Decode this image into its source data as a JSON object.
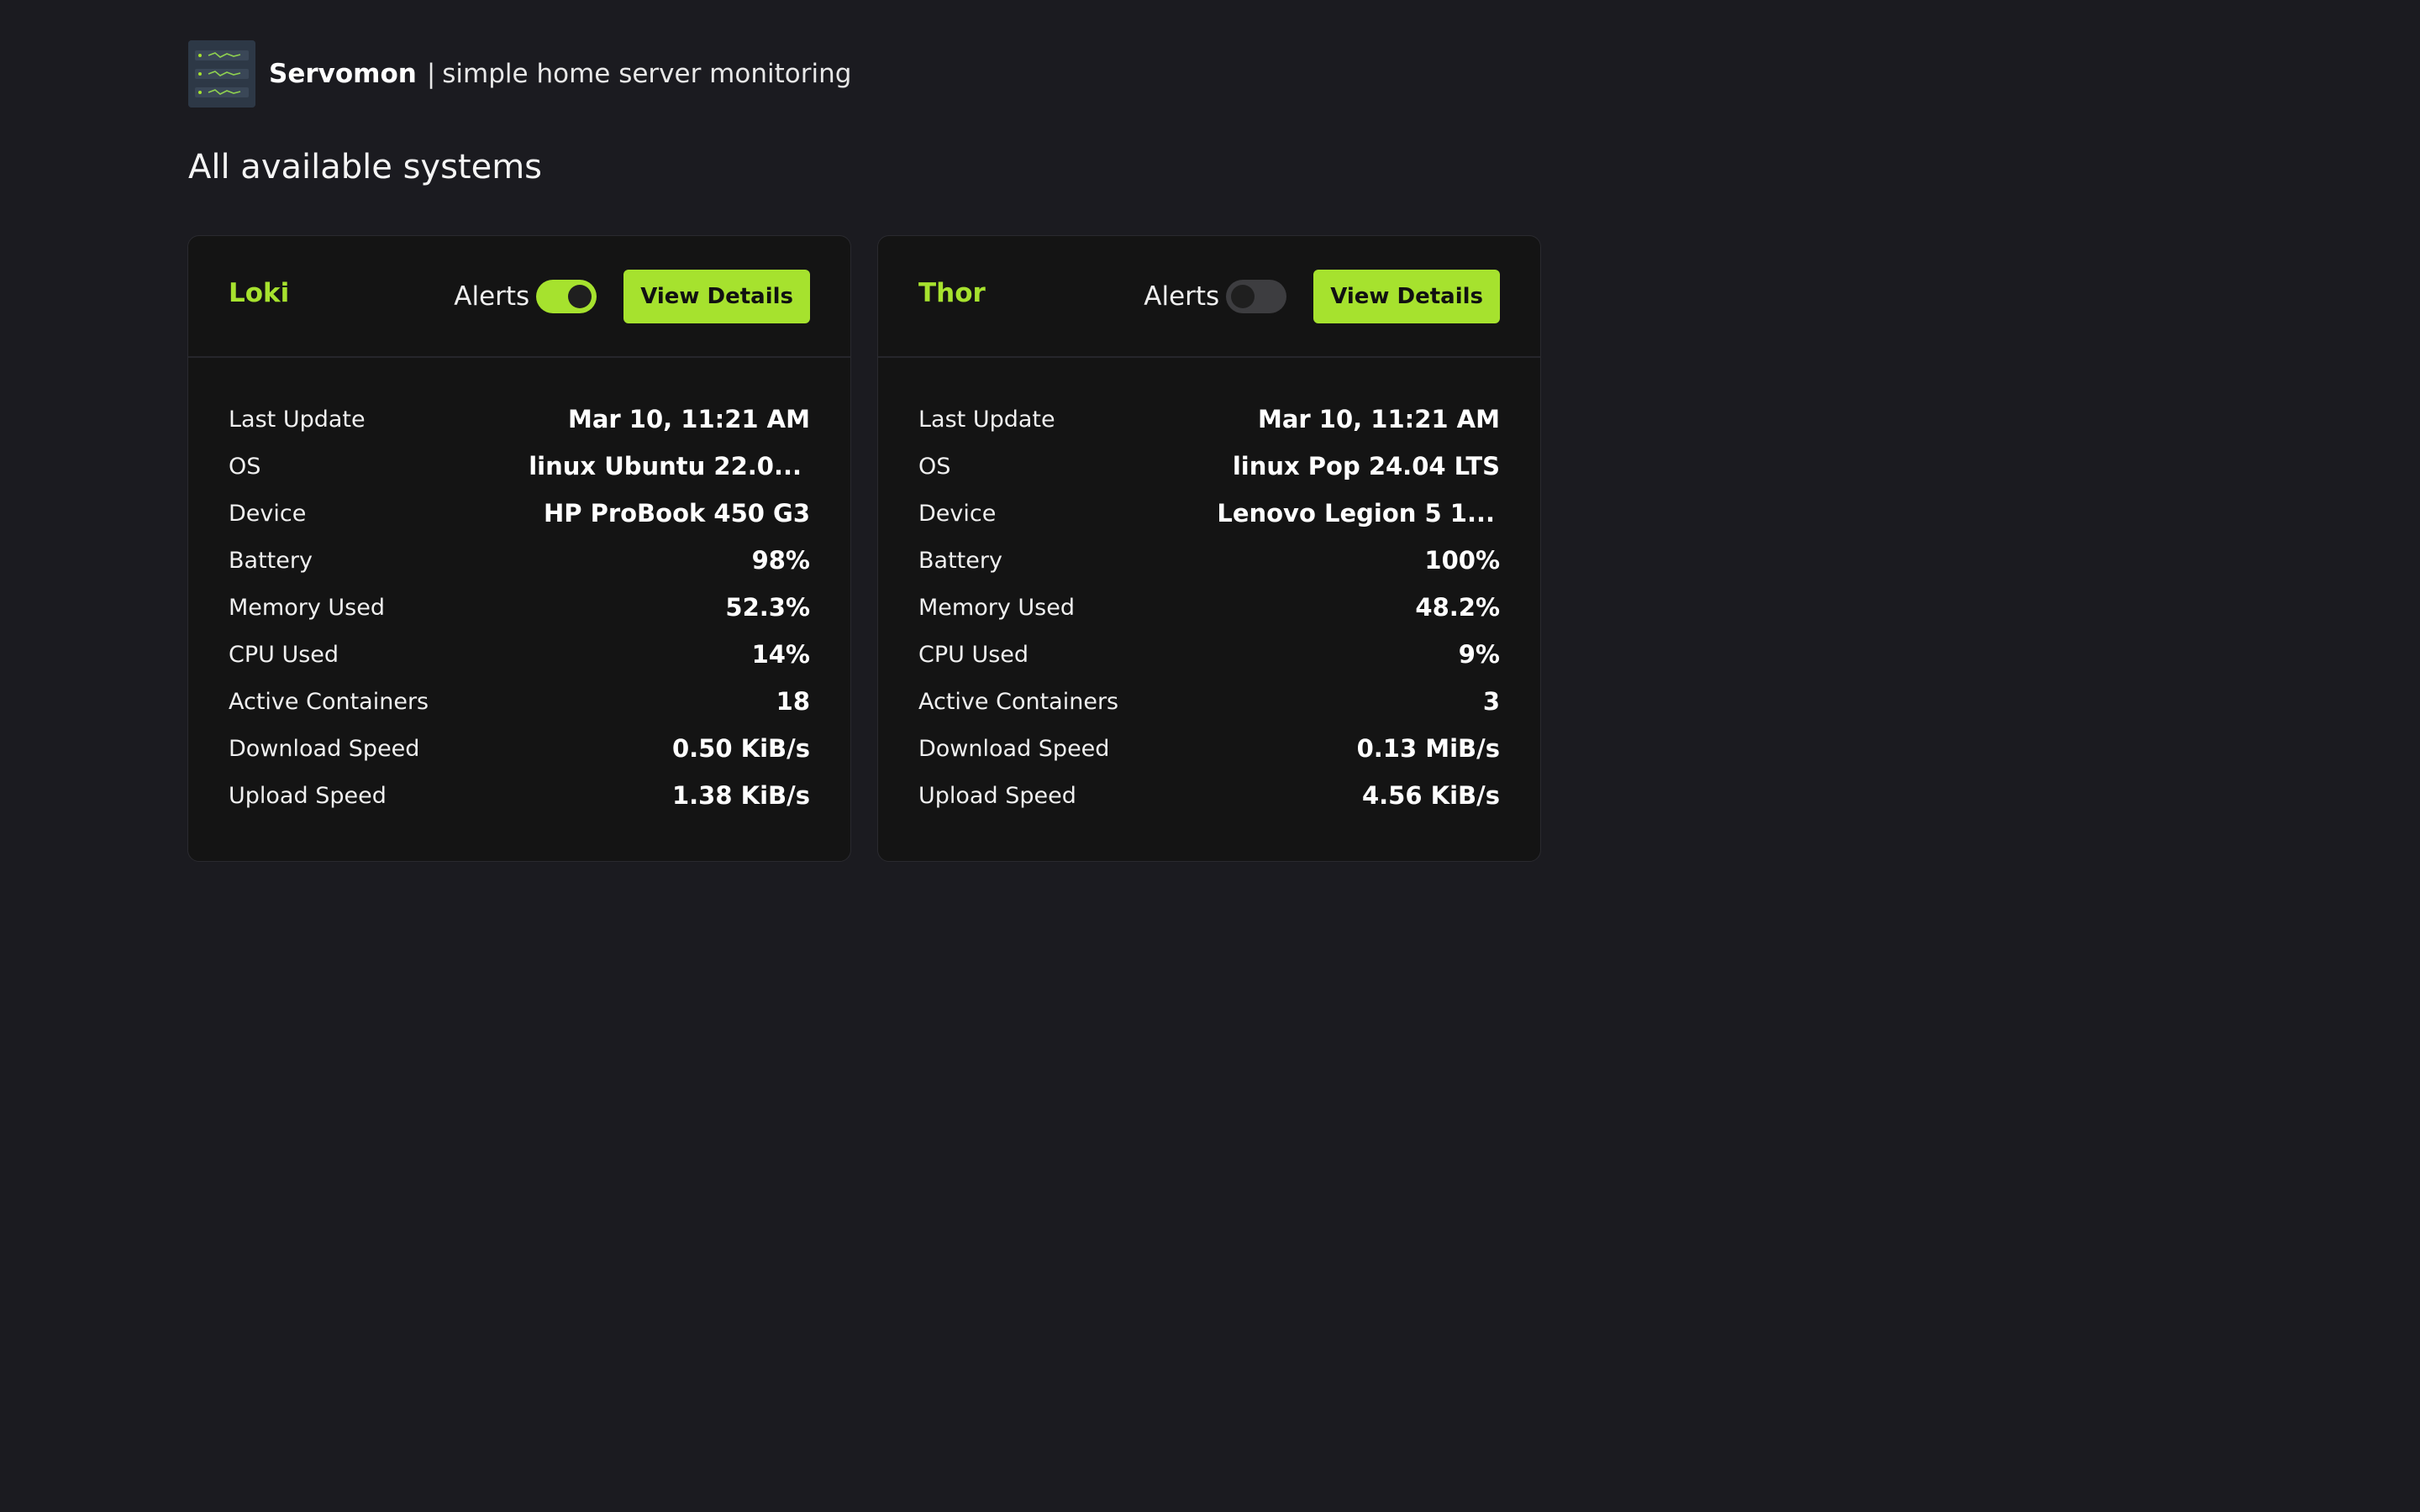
{
  "header": {
    "brand_name": "Servomon",
    "separator": "|",
    "tagline": "simple home server monitoring"
  },
  "section_title": "All available systems",
  "colors": {
    "accent": "#a6e22e",
    "background": "#1b1b20",
    "card": "#141414"
  },
  "systems": [
    {
      "name": "Loki",
      "alerts_label": "Alerts",
      "alerts_enabled": true,
      "button_label": "View Details",
      "rows": [
        {
          "label": "Last Update",
          "value": "Mar 10, 11:21 AM"
        },
        {
          "label": "OS",
          "value": "linux Ubuntu 22.0..."
        },
        {
          "label": "Device",
          "value": "HP ProBook 450 G3"
        },
        {
          "label": "Battery",
          "value": "98%"
        },
        {
          "label": "Memory Used",
          "value": "52.3%"
        },
        {
          "label": "CPU Used",
          "value": "14%"
        },
        {
          "label": "Active Containers",
          "value": "18"
        },
        {
          "label": "Download Speed",
          "value": "0.50 KiB/s"
        },
        {
          "label": "Upload Speed",
          "value": "1.38 KiB/s"
        }
      ]
    },
    {
      "name": "Thor",
      "alerts_label": "Alerts",
      "alerts_enabled": false,
      "button_label": "View Details",
      "rows": [
        {
          "label": "Last Update",
          "value": "Mar 10, 11:21 AM"
        },
        {
          "label": "OS",
          "value": "linux Pop 24.04 LTS"
        },
        {
          "label": "Device",
          "value": "Lenovo Legion 5 1..."
        },
        {
          "label": "Battery",
          "value": "100%"
        },
        {
          "label": "Memory Used",
          "value": "48.2%"
        },
        {
          "label": "CPU Used",
          "value": "9%"
        },
        {
          "label": "Active Containers",
          "value": "3"
        },
        {
          "label": "Download Speed",
          "value": "0.13 MiB/s"
        },
        {
          "label": "Upload Speed",
          "value": "4.56 KiB/s"
        }
      ]
    }
  ]
}
